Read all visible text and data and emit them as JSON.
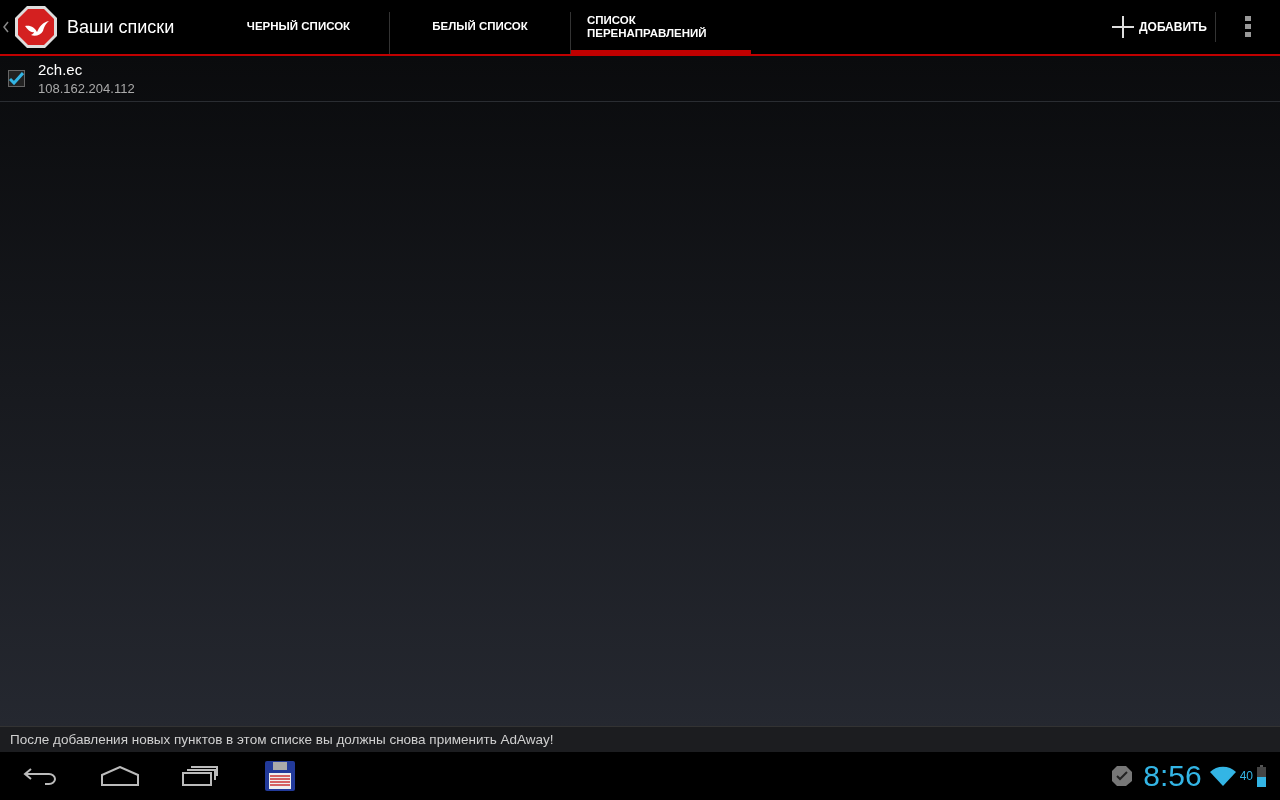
{
  "action_bar": {
    "title": "Ваши списки",
    "tabs": [
      {
        "label": "ЧЕРНЫЙ СПИСОК",
        "selected": false
      },
      {
        "label": "БЕЛЫЙ СПИСОК",
        "selected": false
      },
      {
        "label": "СПИСОК ПЕРЕНАПРАВЛЕНИЙ",
        "selected": true
      }
    ],
    "add_button": "ДОБАВИТЬ"
  },
  "entries": [
    {
      "host": "2ch.ec",
      "address": "108.162.204.112",
      "checked": true
    }
  ],
  "notice": "После добавления новых пунктов в этом списке вы должны снова применить AdAway!",
  "system_bar": {
    "time": "8:56",
    "signal_reading": "40"
  }
}
